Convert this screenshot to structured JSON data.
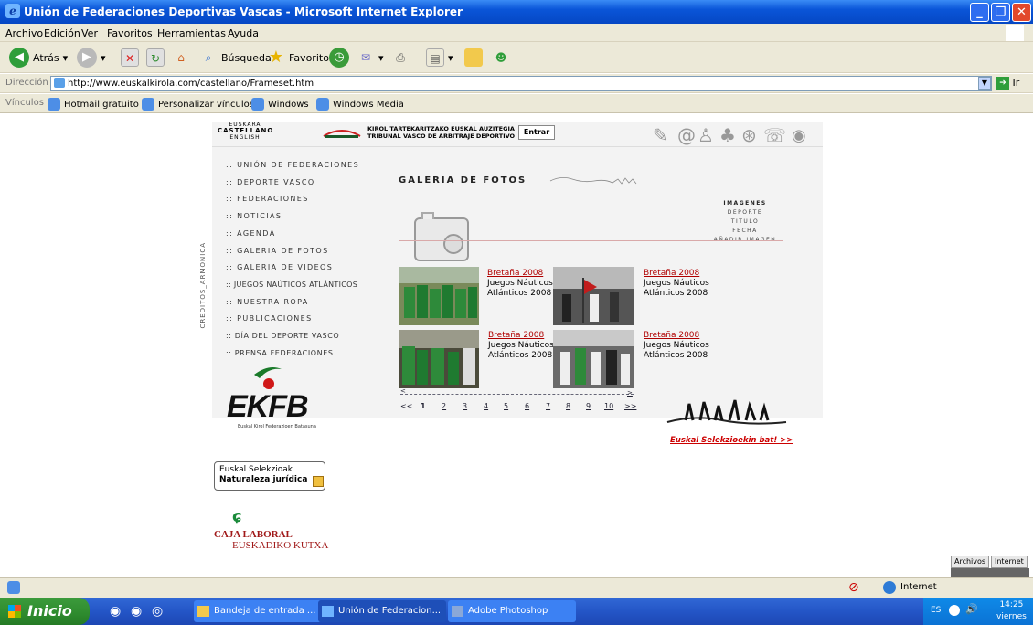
{
  "window": {
    "title": "Unión de Federaciones Deportivas Vascas - Microsoft Internet Explorer"
  },
  "menu": [
    "Archivo",
    "Edición",
    "Ver",
    "Favoritos",
    "Herramientas",
    "Ayuda"
  ],
  "toolbar": {
    "back": "Atrás",
    "search": "Búsqueda",
    "favorites": "Favoritos"
  },
  "address": {
    "label": "Dirección",
    "url": "http://www.euskalkirola.com/castellano/Frameset.htm",
    "go": "Ir"
  },
  "links": {
    "label": "Vínculos",
    "items": [
      "Hotmail gratuito",
      "Personalizar vínculos",
      "Windows",
      "Windows Media"
    ]
  },
  "page": {
    "languages": [
      "EUSKARA",
      "CASTELLANO",
      "ENGLISH"
    ],
    "tribunal_line1": "KIROL TARTEKARITZAKO EUSKAL AUZITEGIA",
    "tribunal_line2": "TRIBUNAL VASCO DE ARBITRAJE DEPORTIVO",
    "entrar": "Entrar",
    "nav": [
      ":: UNIÓN DE FEDERACIONES",
      ":: DEPORTE VASCO",
      ":: FEDERACIONES",
      ":: NOTICIAS",
      ":: AGENDA",
      ":: GALERIA DE FOTOS",
      ":: GALERIA DE VIDEOS",
      ":: JUEGOS NAÚTICOS ATLÁNTICOS",
      ":: NUESTRA ROPA",
      ":: PUBLICACIONES",
      ":: DÍA DEL DEPORTE VASCO",
      ":: PRENSA FEDERACIONES"
    ],
    "credit": "CREDITOS_ARMONICA",
    "gallery_title": "GALERIA DE FOTOS",
    "right_menu": [
      "IMAGENES",
      "DEPORTE",
      "TITULO",
      "FECHA",
      "AÑADIR IMAGEN"
    ],
    "photos": [
      {
        "link": "Bretaña 2008",
        "line1": "Juegos Náuticos",
        "line2": "Atlánticos 2008"
      },
      {
        "link": "Bretaña 2008",
        "line1": "Juegos Náuticos",
        "line2": "Atlánticos 2008"
      },
      {
        "link": "Bretaña 2008",
        "line1": "Juegos Náuticos",
        "line2": "Atlánticos 2008"
      },
      {
        "link": "Bretaña 2008",
        "line1": "Juegos Náuticos",
        "line2": "Atlánticos 2008"
      }
    ],
    "pager": {
      "prev": "<<",
      "pages": [
        "1",
        "2",
        "3",
        "4",
        "5",
        "6",
        "7",
        "8",
        "9",
        "10"
      ],
      "next": ">>",
      "current": "1",
      "arrow_left": "<",
      "arrow_right": ">"
    },
    "ekfb": "EKFB",
    "ekfb_sub": "Euskal Kirol Federazioen Batasuna",
    "selekzioak_link": "Euskal Selekzioekin bat! >>",
    "naturaleza_line1": "Euskal Selekzioak",
    "naturaleza_line2": "Naturaleza jurídica",
    "caja_line1": "CAJA LABORAL",
    "caja_line2": "EUSKADIKO KUTXA",
    "side_buttons": [
      "Archivos",
      "Internet"
    ]
  },
  "status": {
    "zone": "Internet"
  },
  "taskbar": {
    "start": "Inicio",
    "tasks": [
      "Bandeja de entrada ...",
      "Unión de Federacion...",
      "Adobe Photoshop"
    ],
    "lang": "ES",
    "time": "14:25",
    "day": "viernes"
  }
}
